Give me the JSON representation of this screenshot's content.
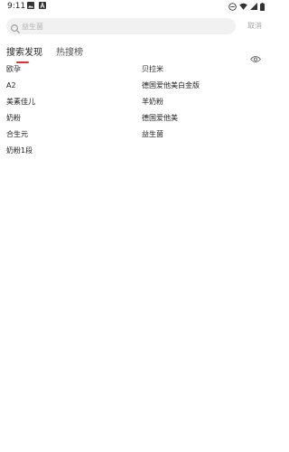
{
  "status_bar": {
    "time": "9:11"
  },
  "search": {
    "placeholder": "益生菌",
    "value": "",
    "cancel_label": "取消"
  },
  "tabs": [
    {
      "label": "搜索发现",
      "active": true
    },
    {
      "label": "热搜榜",
      "active": false
    }
  ],
  "discover_items": {
    "left": [
      "欧孕",
      "A2",
      "美素佳儿",
      "奶粉",
      "合生元",
      "奶粉1段"
    ],
    "right": [
      "贝拉米",
      "德国爱他美白金版",
      "羊奶粉",
      "德国爱他美",
      "益生菌"
    ]
  },
  "colors": {
    "accent": "#e02e2e",
    "search_bg": "#f1f1f1",
    "muted_text": "#a6a6a6"
  }
}
